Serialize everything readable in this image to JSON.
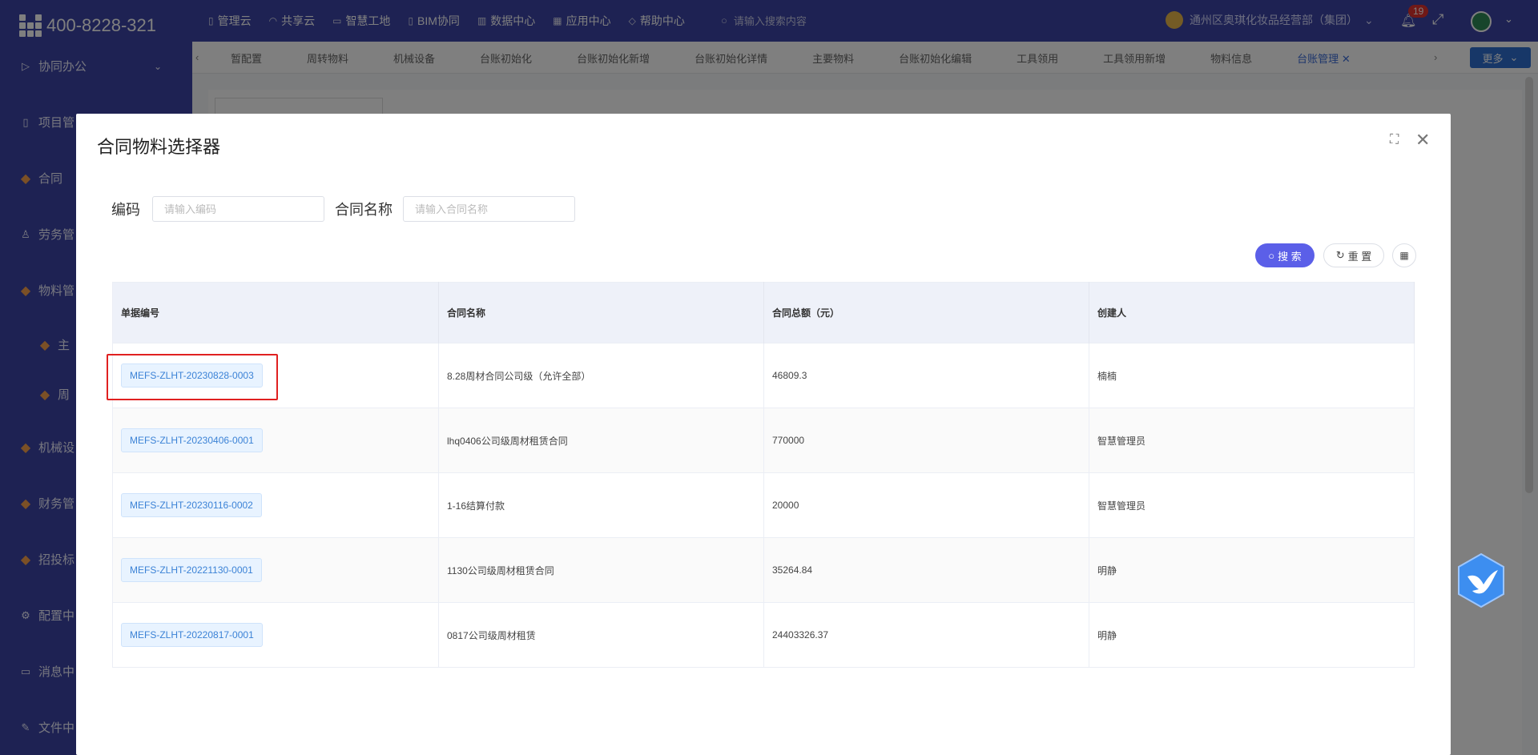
{
  "header": {
    "phone": "400-8228-321",
    "nav": [
      {
        "icon": "document-icon",
        "label": "管理云"
      },
      {
        "icon": "share-icon",
        "label": "共享云"
      },
      {
        "icon": "monitor-icon",
        "label": "智慧工地"
      },
      {
        "icon": "bim-icon",
        "label": "BIM协同"
      },
      {
        "icon": "chart-icon",
        "label": "数据中心"
      },
      {
        "icon": "grid-icon",
        "label": "应用中心"
      },
      {
        "icon": "help-icon",
        "label": "帮助中心"
      }
    ],
    "search_placeholder": "请输入搜索内容",
    "org": "通州区奥琪化妆品经营部（集团）",
    "notification_count": "19"
  },
  "sidebar": {
    "items": [
      {
        "label": "协同办公",
        "icon": "send-icon"
      },
      {
        "label": "项目管",
        "icon": "book-icon"
      },
      {
        "label": "合同",
        "icon": "gem-icon"
      },
      {
        "label": "劳务管",
        "icon": "user-icon"
      },
      {
        "label": "物料管",
        "icon": "gem-icon"
      },
      {
        "label": "主",
        "icon": "gem-icon"
      },
      {
        "label": "周",
        "icon": "gem-icon"
      },
      {
        "label": "机械设",
        "icon": "gem-icon"
      },
      {
        "label": "财务管",
        "icon": "gem-icon"
      },
      {
        "label": "招投标",
        "icon": "gem-icon"
      },
      {
        "label": "配置中",
        "icon": "gear-icon"
      },
      {
        "label": "消息中",
        "icon": "message-icon"
      },
      {
        "label": "文件中",
        "icon": "file-icon"
      }
    ]
  },
  "tabs": {
    "items": [
      "暂配置",
      "周转物料",
      "机械设备",
      "台账初始化",
      "台账初始化新增",
      "台账初始化详情",
      "主要物料",
      "台账初始化编辑",
      "工具领用",
      "工具领用新增",
      "物料信息",
      "台账管理"
    ],
    "more_label": "更多"
  },
  "modal": {
    "title": "合同物料选择器",
    "filters": {
      "code_label": "编码",
      "code_placeholder": "请输入编码",
      "name_label": "合同名称",
      "name_placeholder": "请输入合同名称"
    },
    "search_label": "搜 索",
    "reset_label": "重 置",
    "table": {
      "headers": [
        "单据编号",
        "合同名称",
        "合同总额（元）",
        "创建人"
      ],
      "rows": [
        {
          "code": "MEFS-ZLHT-20230828-0003",
          "name": "8.28周材合同公司级（允许全部）",
          "amount": "46809.3",
          "creator": "楠楠"
        },
        {
          "code": "MEFS-ZLHT-20230406-0001",
          "name": "lhq0406公司级周材租赁合同",
          "amount": "770000",
          "creator": "智慧管理员"
        },
        {
          "code": "MEFS-ZLHT-20230116-0002",
          "name": "1-16结算付款",
          "amount": "20000",
          "creator": "智慧管理员"
        },
        {
          "code": "MEFS-ZLHT-20221130-0001",
          "name": "1130公司级周材租赁合同",
          "amount": "35264.84",
          "creator": "明静"
        },
        {
          "code": "MEFS-ZLHT-20220817-0001",
          "name": "0817公司级周材租赁",
          "amount": "24403326.37",
          "creator": "明静"
        }
      ]
    }
  }
}
